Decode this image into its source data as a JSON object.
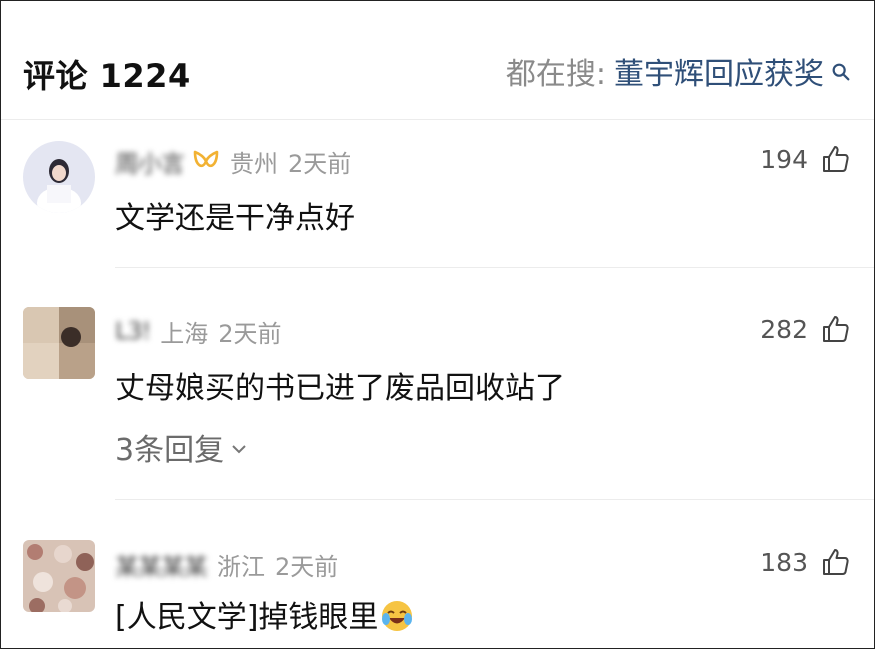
{
  "header": {
    "title": "评论 1224",
    "search_prefix": "都在搜:",
    "search_term": "董宇辉回应获奖"
  },
  "comments": [
    {
      "username": "周小言",
      "location": "贵州",
      "time": "2天前",
      "likes": "194",
      "text": "文学还是干净点好",
      "badge": "vip-badge-icon"
    },
    {
      "username": "L3!",
      "location": "上海",
      "time": "2天前",
      "likes": "282",
      "text": "丈母娘买的书已进了废品回收站了",
      "replies": "3条回复"
    },
    {
      "username": "某某某某",
      "location": "浙江",
      "time": "2天前",
      "likes": "183",
      "text": "[人民文学]掉钱眼里",
      "emoji": "crying-laughing-emoji-icon"
    }
  ],
  "colors": {
    "link": "#2f4f78",
    "muted": "#9a9a9a",
    "badge": "#f2b233"
  }
}
